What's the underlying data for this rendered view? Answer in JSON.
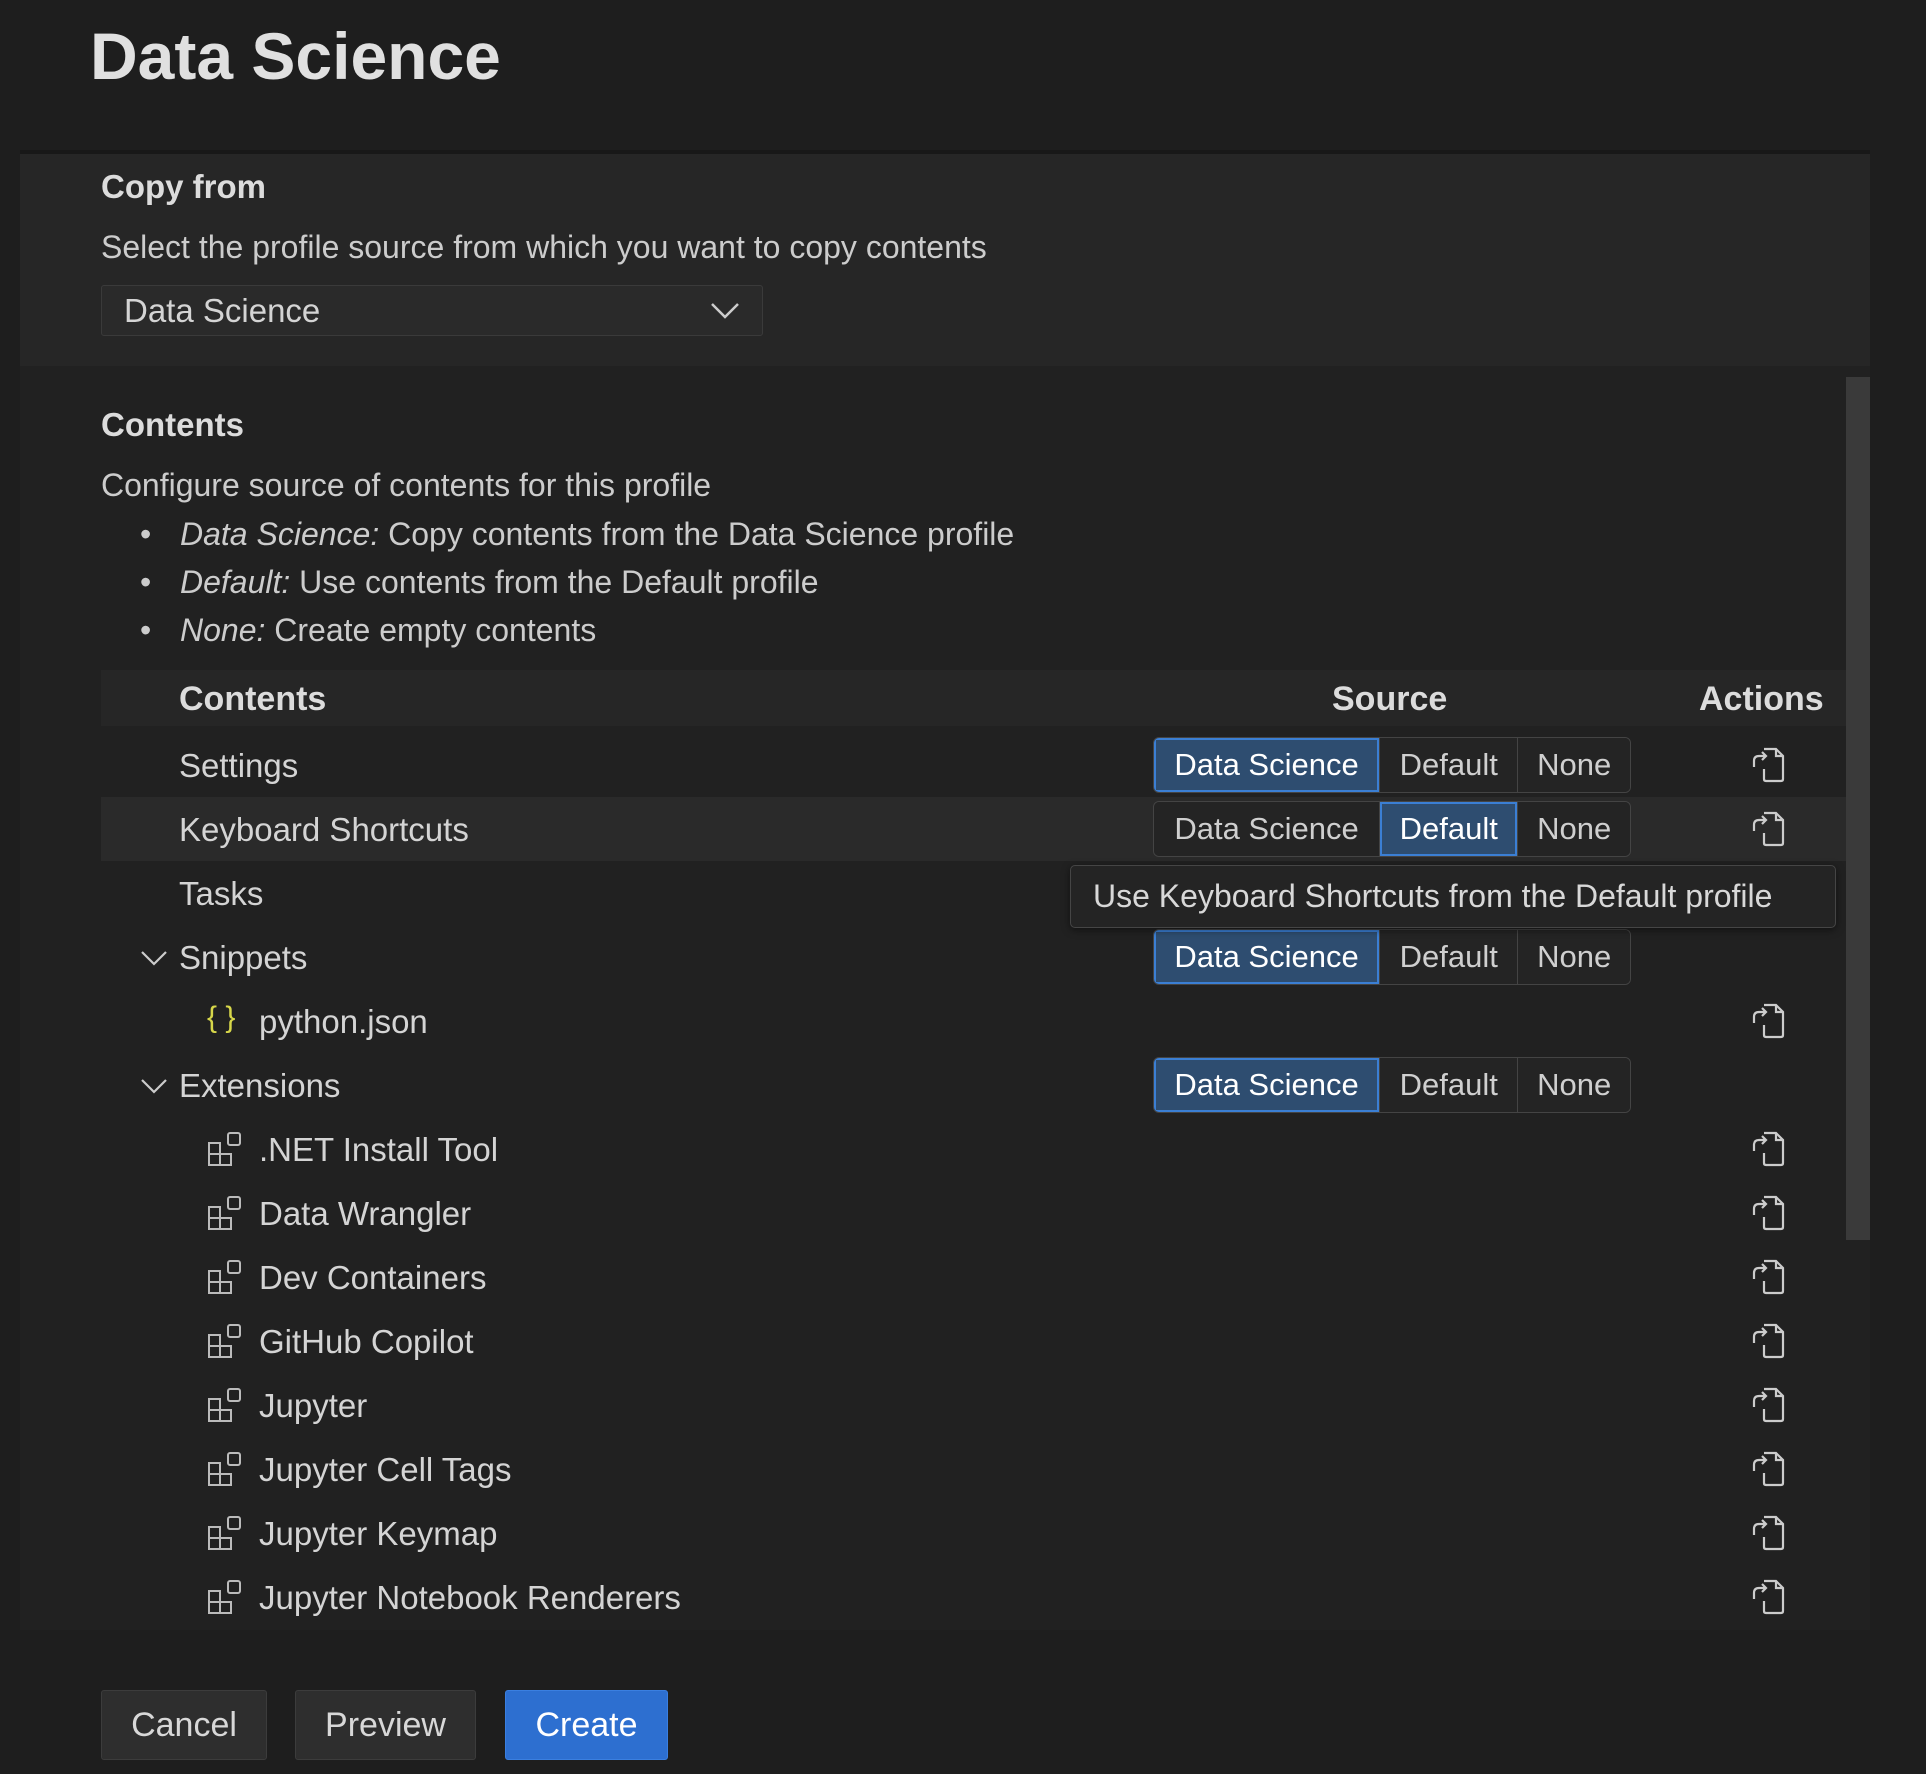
{
  "title": "Data Science",
  "copy_from": {
    "heading": "Copy from",
    "description": "Select the profile source from which you want to copy contents",
    "selected": "Data Science"
  },
  "contents": {
    "heading": "Contents",
    "description": "Configure source of contents for this profile",
    "bullets": [
      {
        "term": "Data Science:",
        "text": " Copy contents from the Data Science profile"
      },
      {
        "term": "Default:",
        "text": " Use contents from the Default profile"
      },
      {
        "term": "None:",
        "text": " Create empty contents"
      }
    ]
  },
  "table": {
    "headers": {
      "contents": "Contents",
      "source": "Source",
      "actions": "Actions"
    },
    "options": [
      "Data Science",
      "Default",
      "None"
    ],
    "rows": [
      {
        "label": "Settings",
        "selected": "Data Science",
        "action": true
      },
      {
        "label": "Keyboard Shortcuts",
        "selected": "Default",
        "action": true,
        "hovered": true
      },
      {
        "label": "Tasks"
      },
      {
        "label": "Snippets",
        "expandable": true,
        "selected": "Data Science"
      },
      {
        "label": "python.json",
        "child": true,
        "icon": "json-braces-icon",
        "action": true
      },
      {
        "label": "Extensions",
        "expandable": true,
        "selected": "Data Science"
      },
      {
        "label": ".NET Install Tool",
        "child": true,
        "icon": "extension-icon",
        "action": true
      },
      {
        "label": "Data Wrangler",
        "child": true,
        "icon": "extension-icon",
        "action": true
      },
      {
        "label": "Dev Containers",
        "child": true,
        "icon": "extension-icon",
        "action": true
      },
      {
        "label": "GitHub Copilot",
        "child": true,
        "icon": "extension-icon",
        "action": true
      },
      {
        "label": "Jupyter",
        "child": true,
        "icon": "extension-icon",
        "action": true
      },
      {
        "label": "Jupyter Cell Tags",
        "child": true,
        "icon": "extension-icon",
        "action": true
      },
      {
        "label": "Jupyter Keymap",
        "child": true,
        "icon": "extension-icon",
        "action": true
      },
      {
        "label": "Jupyter Notebook Renderers",
        "child": true,
        "icon": "extension-icon",
        "action": true
      }
    ]
  },
  "tooltip": "Use Keyboard Shortcuts from the Default profile",
  "buttons": {
    "cancel": "Cancel",
    "preview": "Preview",
    "create": "Create"
  },
  "colors": {
    "accent": "#2d6fd0",
    "selected_segment": "#2e4d70",
    "json_icon": "#d7d74a"
  }
}
